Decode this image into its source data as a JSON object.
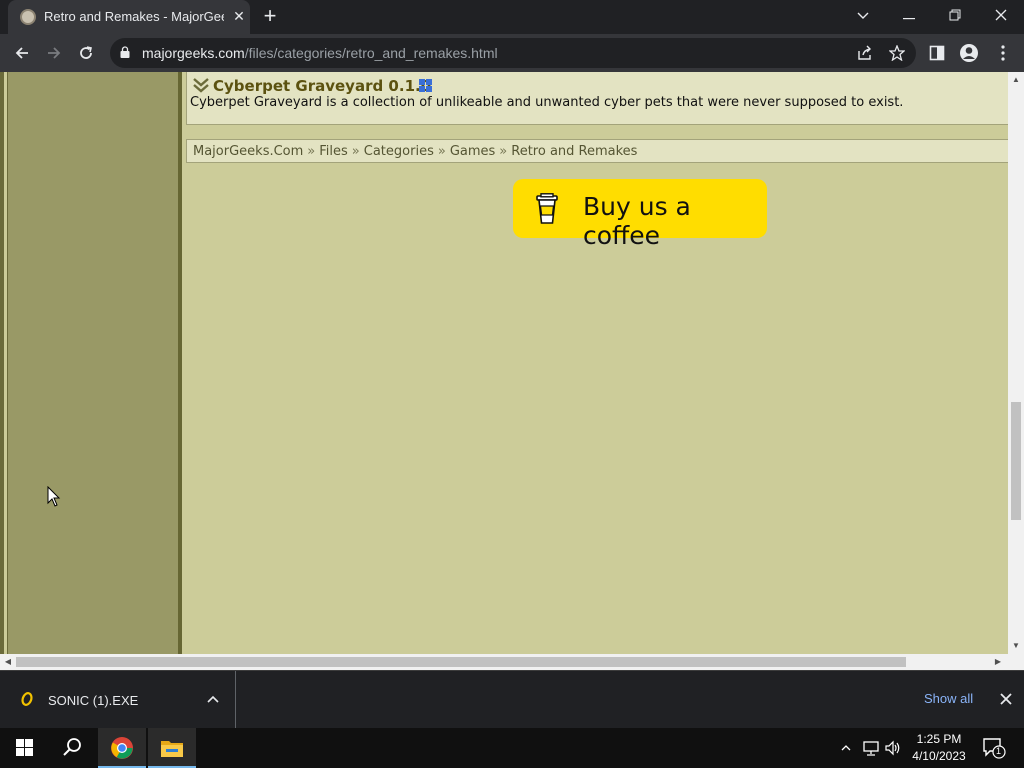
{
  "browser": {
    "tab_title": "Retro and Remakes - MajorGeeks",
    "tab_close": "✕",
    "new_tab": "+",
    "url_domain": "majorgeeks.com",
    "url_path": "/files/categories/retro_and_remakes.html",
    "window_controls": {
      "dropdown": "⌄",
      "minimize": "—",
      "restore": "❐",
      "close": "✕"
    }
  },
  "page": {
    "item": {
      "title": "Cyberpet Graveyard 0.1.0",
      "description": "Cyberpet Graveyard is a collection of unlikeable and unwanted cyber pets that were never supposed to exist."
    },
    "breadcrumb": {
      "items": [
        "MajorGeeks.Com",
        "Files",
        "Categories",
        "Games",
        "Retro and Remakes"
      ],
      "separator": "»"
    },
    "coffee_button": {
      "label": "Buy us a coffee"
    },
    "colors": {
      "page_bg": "#cccc99",
      "sidebar_bg": "#999966",
      "title_color": "#5c5210",
      "coffee_bg": "#ffdd00"
    }
  },
  "download_bar": {
    "file_name": "SONIC (1).EXE",
    "show_all": "Show all"
  },
  "taskbar": {
    "time": "1:25 PM",
    "date": "4/10/2023",
    "notification_count": "1"
  }
}
